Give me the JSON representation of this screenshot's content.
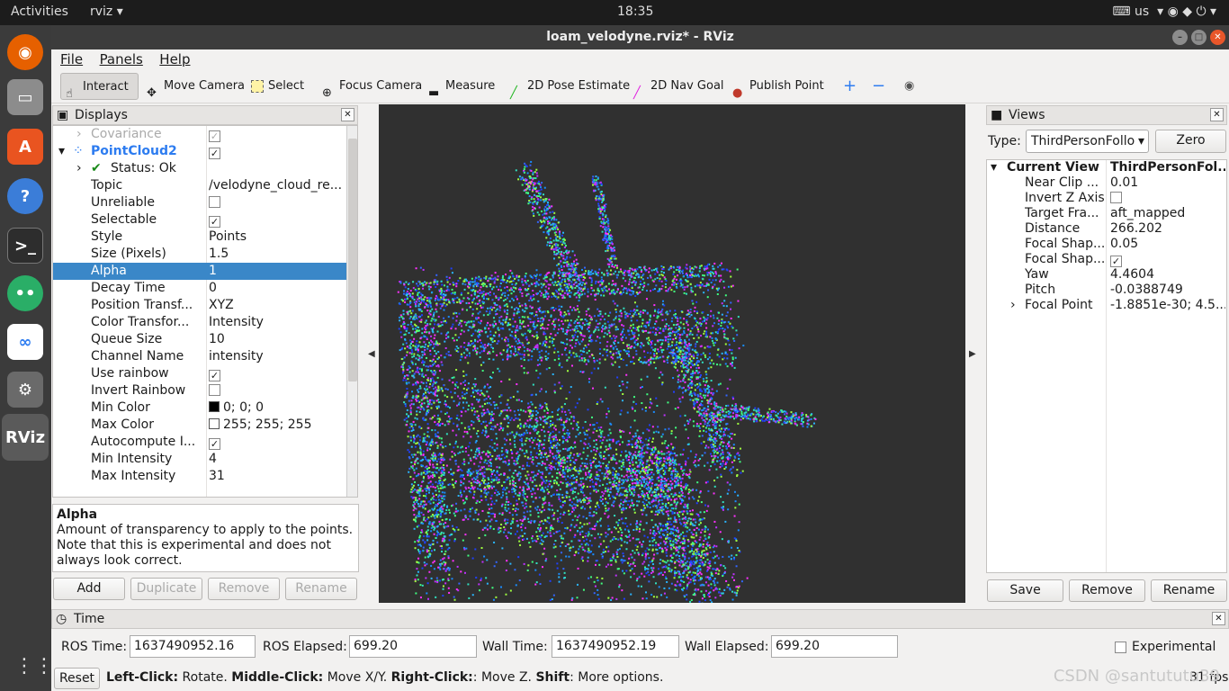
{
  "topbar": {
    "activities": "Activities",
    "app_menu": "rviz ▾",
    "clock": "18:35",
    "keyboard": "us"
  },
  "dock": {
    "items": [
      "firefox",
      "files",
      "software",
      "help",
      "terminal",
      "wechat",
      "baidu",
      "settings",
      "rviz"
    ],
    "rviz_label": "RViz"
  },
  "window": {
    "title": "loam_velodyne.rviz* - RViz"
  },
  "menu": {
    "file": "File",
    "panels": "Panels",
    "help": "Help"
  },
  "toolbar": {
    "interact": "Interact",
    "move_camera": "Move Camera",
    "select": "Select",
    "focus_camera": "Focus Camera",
    "measure": "Measure",
    "pose_estimate": "2D Pose Estimate",
    "nav_goal": "2D Nav Goal",
    "publish_point": "Publish Point"
  },
  "displays": {
    "title": "Displays",
    "covariance": "Covariance",
    "pointcloud": "PointCloud2",
    "status": "Status: Ok",
    "rows": [
      {
        "k": "Topic",
        "v": "/velodyne_cloud_re..."
      },
      {
        "k": "Unreliable",
        "v": ""
      },
      {
        "k": "Selectable",
        "v": "✓"
      },
      {
        "k": "Style",
        "v": "Points"
      },
      {
        "k": "Size (Pixels)",
        "v": "1.5"
      },
      {
        "k": "Alpha",
        "v": "1"
      },
      {
        "k": "Decay Time",
        "v": "0"
      },
      {
        "k": "Position Transf...",
        "v": "XYZ"
      },
      {
        "k": "Color Transfor...",
        "v": "Intensity"
      },
      {
        "k": "Queue Size",
        "v": "10"
      },
      {
        "k": "Channel Name",
        "v": "intensity"
      },
      {
        "k": "Use rainbow",
        "v": "✓"
      },
      {
        "k": "Invert Rainbow",
        "v": ""
      },
      {
        "k": "Min Color",
        "v": "0; 0; 0"
      },
      {
        "k": "Max Color",
        "v": "255; 255; 255"
      },
      {
        "k": "Autocompute I...",
        "v": "✓"
      },
      {
        "k": "Min Intensity",
        "v": "4"
      },
      {
        "k": "Max Intensity",
        "v": "31"
      }
    ]
  },
  "description": {
    "title": "Alpha",
    "text": "Amount of transparency to apply to the points. Note that this is experimental and does not always look correct."
  },
  "display_buttons": {
    "add": "Add",
    "duplicate": "Duplicate",
    "remove": "Remove",
    "rename": "Rename"
  },
  "views": {
    "title": "Views",
    "type_label": "Type:",
    "type_value": "ThirdPersonFollo",
    "zero": "Zero",
    "current_view": "Current View",
    "current_value": "ThirdPersonFol...",
    "rows": [
      {
        "k": "Near Clip ...",
        "v": "0.01"
      },
      {
        "k": "Invert Z Axis",
        "v": ""
      },
      {
        "k": "Target Fra...",
        "v": "aft_mapped"
      },
      {
        "k": "Distance",
        "v": "266.202"
      },
      {
        "k": "Focal Shap...",
        "v": "0.05"
      },
      {
        "k": "Focal Shap...",
        "v": "✓"
      },
      {
        "k": "Yaw",
        "v": "4.4604"
      },
      {
        "k": "Pitch",
        "v": "-0.0388749"
      },
      {
        "k": "Focal Point",
        "v": "-1.8851e-30; 4.5..."
      }
    ],
    "save": "Save",
    "remove": "Remove",
    "rename": "Rename"
  },
  "time": {
    "title": "Time",
    "ros_time_label": "ROS Time:",
    "ros_time": "1637490952.16",
    "ros_elapsed_label": "ROS Elapsed:",
    "ros_elapsed": "699.20",
    "wall_time_label": "Wall Time:",
    "wall_time": "1637490952.19",
    "wall_elapsed_label": "Wall Elapsed:",
    "wall_elapsed": "699.20",
    "experimental": "Experimental"
  },
  "status": {
    "reset": "Reset",
    "lc": "Left-Click:",
    "lc_t": " Rotate. ",
    "mc": "Middle-Click:",
    "mc_t": " Move X/Y. ",
    "rc": "Right-Click:",
    "rc_t": ": Move Z. ",
    "sh": "Shift",
    "sh_t": ": More options.",
    "fps": "31 fps"
  },
  "watermark": "CSDN @santututu39"
}
